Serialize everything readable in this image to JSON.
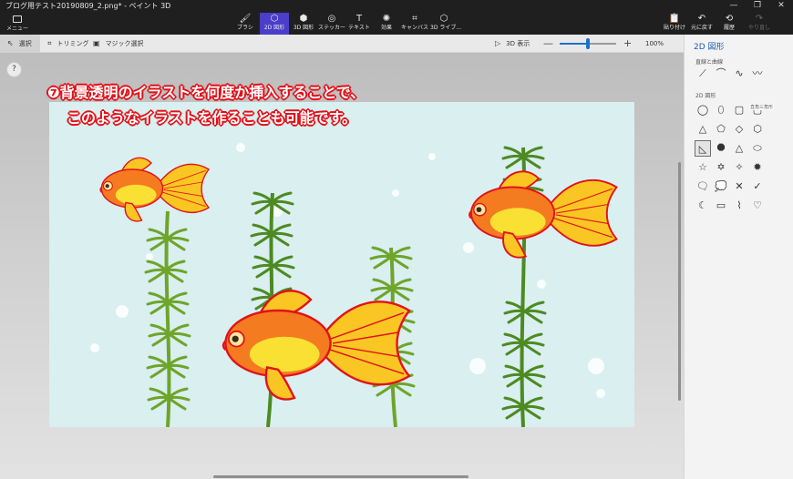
{
  "window": {
    "title": "ブログ用テスト20190809_2.png* - ペイント 3D",
    "controls": [
      "—",
      "❐",
      "✕"
    ]
  },
  "ribbon": {
    "menu_label": "メニュー",
    "tools": [
      {
        "label": "ブラシ",
        "icon": "brush-icon",
        "glyph": "🖌"
      },
      {
        "label": "2D 図形",
        "icon": "2d-shapes-icon",
        "glyph": "⬡"
      },
      {
        "label": "3D 図形",
        "icon": "3d-shapes-icon",
        "glyph": "⬢"
      },
      {
        "label": "ステッカー",
        "icon": "stickers-icon",
        "glyph": "◎"
      },
      {
        "label": "テキスト",
        "icon": "text-icon",
        "glyph": "T"
      },
      {
        "label": "効果",
        "icon": "effects-icon",
        "glyph": "✺"
      },
      {
        "label": "キャンバス",
        "icon": "canvas-icon",
        "glyph": "⌗"
      },
      {
        "label": "3D ライブ...",
        "icon": "3d-library-icon",
        "glyph": "⬡"
      }
    ],
    "right_tools": [
      {
        "label": "貼り付け",
        "icon": "paste-icon",
        "glyph": "📋"
      },
      {
        "label": "元に戻す",
        "icon": "undo-icon",
        "glyph": "↶"
      },
      {
        "label": "履歴",
        "icon": "history-icon",
        "glyph": "⟲"
      },
      {
        "label": "やり直し",
        "icon": "redo-icon",
        "glyph": "↷"
      }
    ]
  },
  "subbar": {
    "select_label": "選択",
    "crop_label": "トリミング",
    "magic_select_label": "マジック選択",
    "view3d_label": "3D 表示",
    "zoom_minus": "—",
    "zoom_plus": "+",
    "zoom_value": "100%",
    "zoom_level": 0.5
  },
  "help_label": "?",
  "annotation": {
    "line1": "❼背景透明のイラストを何度か挿入することで、",
    "line2": "このようなイラストを作ることも可能です。"
  },
  "panel": {
    "title": "2D 図形",
    "lines_label": "直線と曲線",
    "shapes_label": "2D 図形",
    "tooltip": "直角三角形",
    "lines": [
      {
        "icon": "line-icon",
        "glyph": "⟋"
      },
      {
        "icon": "curve-icon",
        "glyph": "⌒"
      },
      {
        "icon": "two-point-curve-icon",
        "glyph": "∿"
      },
      {
        "icon": "three-point-curve-icon",
        "glyph": "〰"
      }
    ],
    "shapes": [
      {
        "icon": "circle-icon",
        "glyph": "◯"
      },
      {
        "icon": "oval-icon",
        "glyph": "⬯"
      },
      {
        "icon": "square-icon",
        "glyph": "▢"
      },
      {
        "icon": "rounded-square-icon",
        "glyph": "▢"
      },
      {
        "icon": "triangle-icon",
        "glyph": "△"
      },
      {
        "icon": "pentagon-icon",
        "glyph": "⬠"
      },
      {
        "icon": "diamond-icon",
        "glyph": "◇"
      },
      {
        "icon": "hexagon-icon",
        "glyph": "⬡"
      },
      {
        "icon": "right-triangle-icon",
        "glyph": "◺"
      },
      {
        "icon": "octagon-icon",
        "glyph": "⯃"
      },
      {
        "icon": "triangle-outline-icon",
        "glyph": "△"
      },
      {
        "icon": "leaf-icon",
        "glyph": "⬭"
      },
      {
        "icon": "star-5-icon",
        "glyph": "☆"
      },
      {
        "icon": "star-6-icon",
        "glyph": "✡"
      },
      {
        "icon": "star-4-icon",
        "glyph": "✧"
      },
      {
        "icon": "burst-icon",
        "glyph": "✹"
      },
      {
        "icon": "speech-bubble-icon",
        "glyph": "🗨"
      },
      {
        "icon": "thought-bubble-icon",
        "glyph": "💭"
      },
      {
        "icon": "cross-icon",
        "glyph": "✕"
      },
      {
        "icon": "check-icon",
        "glyph": "✓"
      },
      {
        "icon": "moon-icon",
        "glyph": "☾"
      },
      {
        "icon": "callout-icon",
        "glyph": "▭"
      },
      {
        "icon": "banner-icon",
        "glyph": "⌇"
      },
      {
        "icon": "heart-icon",
        "glyph": "♡"
      }
    ]
  },
  "colors": {
    "accent": "#4b3ec9",
    "canvas_bg": "#d9eff0",
    "annotation_outline": "#e2121a",
    "goldfish_orange": "#f47b20",
    "goldfish_yellow": "#f9d423",
    "weed_green": "#7fb02b"
  }
}
